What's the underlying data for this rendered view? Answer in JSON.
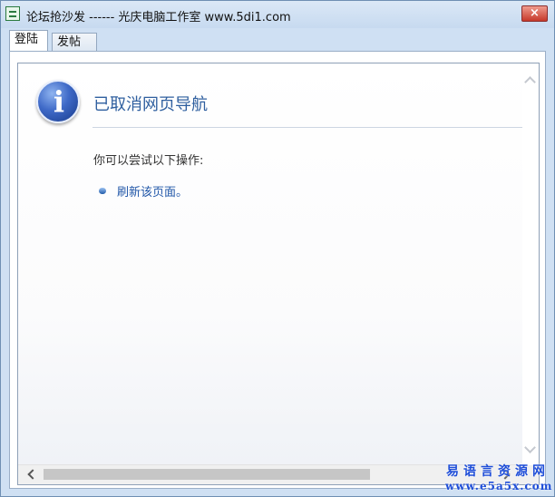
{
  "window": {
    "title": "论坛抢沙发 ------ 光庆电脑工作室    www.5di1.com"
  },
  "tabs": [
    {
      "label": "登陆",
      "active": true
    },
    {
      "label": "发帖",
      "active": false
    }
  ],
  "browser": {
    "heading": "已取消网页导航",
    "hint": "你可以尝试以下操作:",
    "action_link": "刷新该页面。"
  },
  "icons": {
    "app": "app-icon",
    "info": "info-icon",
    "close": "close-icon"
  },
  "watermark": {
    "line1": "易语言资源网",
    "line2": "www.e5a5x.com"
  },
  "colors": {
    "heading": "#2f5f9f",
    "link": "#2056a8",
    "titlebar": "#cfe0f3"
  }
}
